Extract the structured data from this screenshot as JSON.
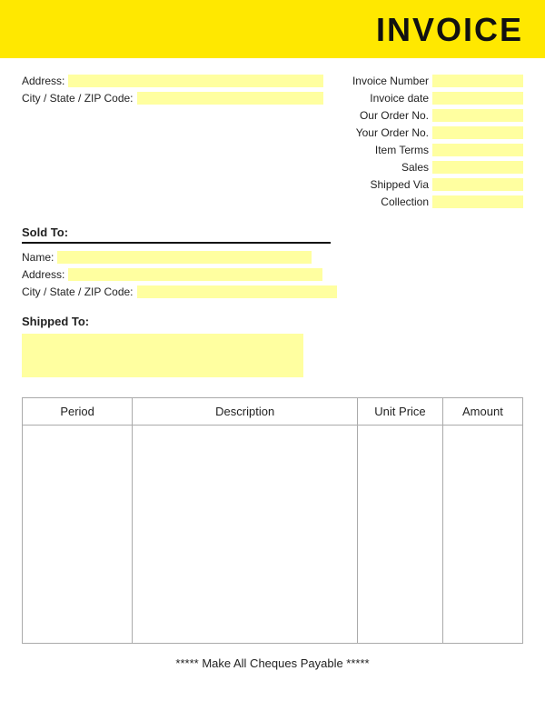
{
  "header": {
    "title": "INVOICE"
  },
  "address_section": {
    "address_label": "Address:",
    "city_label": "City / State / ZIP Code:"
  },
  "right_section": {
    "fields": [
      {
        "label": "Invoice Number",
        "id": "invoice-number"
      },
      {
        "label": "Invoice date",
        "id": "invoice-date"
      },
      {
        "label": "Our Order No.",
        "id": "our-order-no"
      },
      {
        "label": "Your Order No.",
        "id": "your-order-no"
      },
      {
        "label": "Item Terms",
        "id": "item-terms"
      },
      {
        "label": "Sales",
        "id": "sales"
      },
      {
        "label": "Shipped Via",
        "id": "shipped-via"
      },
      {
        "label": "Collection",
        "id": "collection"
      }
    ]
  },
  "sold_to": {
    "label": "Sold To:",
    "name_label": "Name:",
    "address_label": "Address:",
    "city_label": "City / State / ZIP Code:"
  },
  "shipped_to": {
    "label": "Shipped To:"
  },
  "table": {
    "columns": [
      "Period",
      "Description",
      "Unit Price",
      "Amount"
    ]
  },
  "footer": {
    "text": "***** Make All Cheques Payable *****"
  }
}
